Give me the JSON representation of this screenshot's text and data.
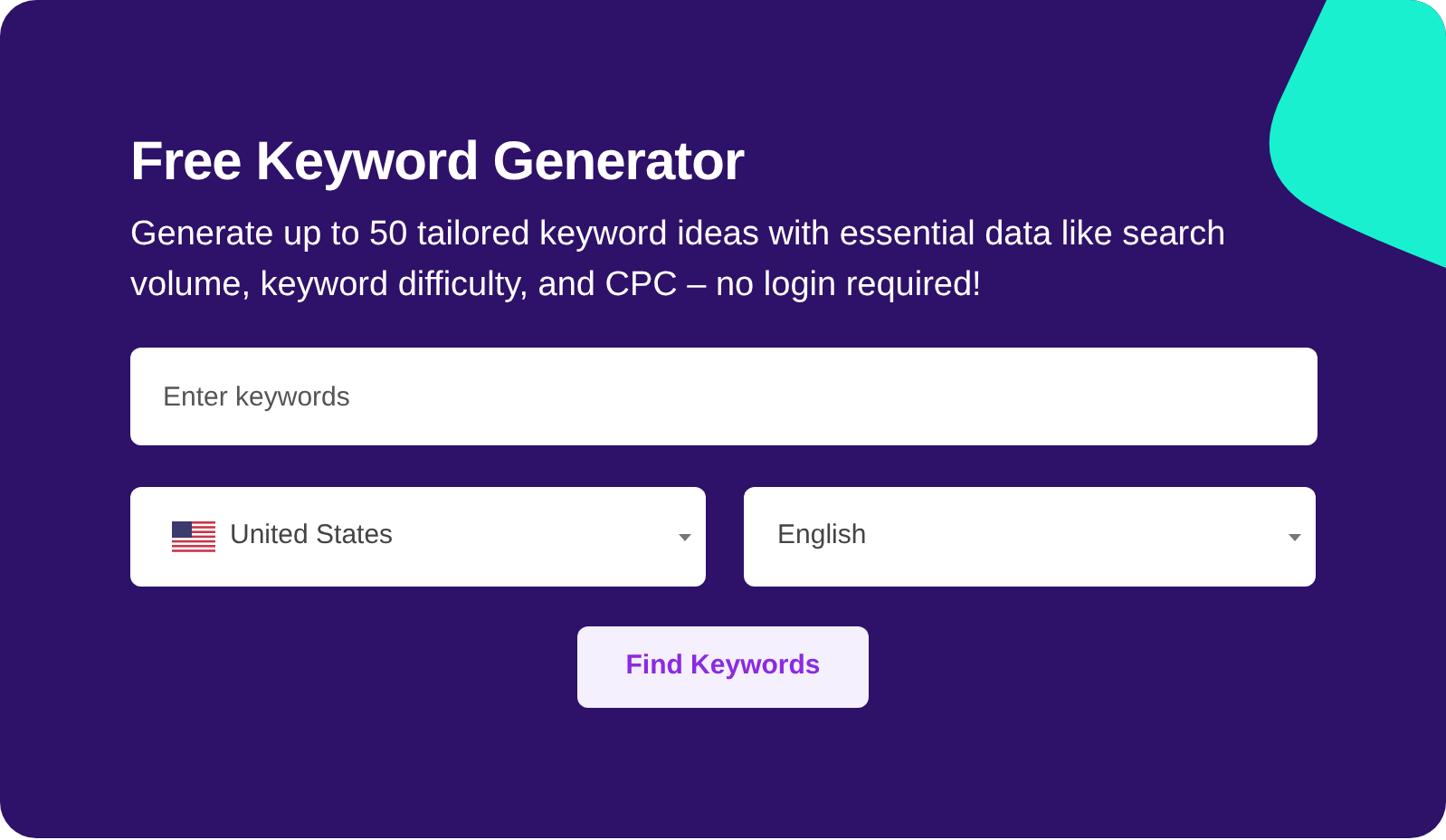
{
  "title": "Free Keyword Generator",
  "subtitle": "Generate up to 50 tailored keyword ideas with essential data like search volume, keyword difficulty, and CPC – no login required!",
  "keyword_field": {
    "placeholder": "Enter keywords"
  },
  "country_select": {
    "value": "United States"
  },
  "language_select": {
    "value": "English"
  },
  "submit_button": {
    "label": "Find Keywords"
  }
}
